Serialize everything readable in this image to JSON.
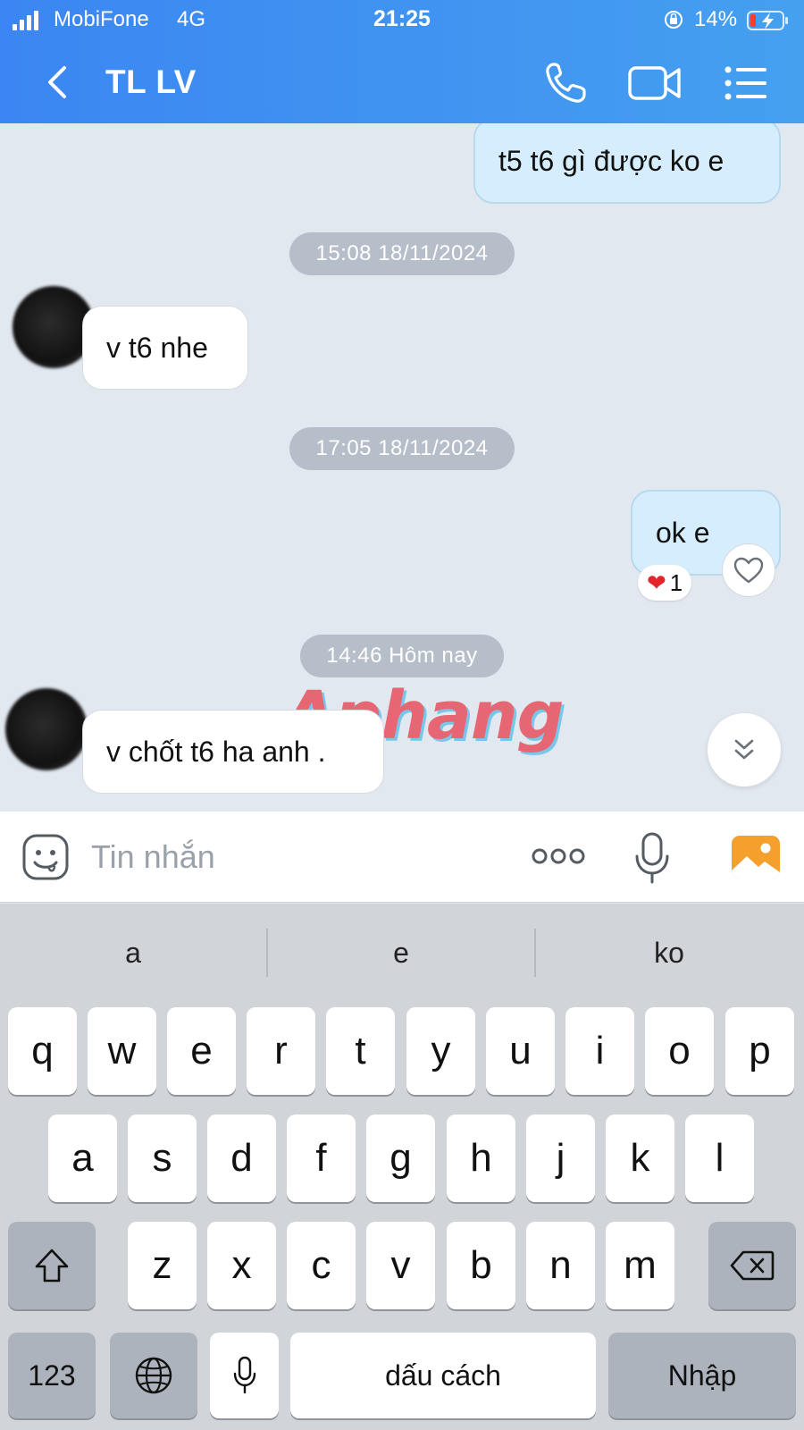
{
  "status_bar": {
    "carrier": "MobiFone",
    "network": "4G",
    "time": "21:25",
    "battery": "14%"
  },
  "header": {
    "title": "TL LV"
  },
  "messages": [
    {
      "sender": "me",
      "text": "t5 t6 gì được ko e"
    },
    {
      "type": "timestamp",
      "text": "15:08 18/11/2024"
    },
    {
      "sender": "them",
      "text": "v t6 nhe"
    },
    {
      "type": "timestamp",
      "text": "17:05 18/11/2024"
    },
    {
      "sender": "me",
      "text": "ok e",
      "reaction": {
        "emoji": "❤",
        "count": "1"
      }
    },
    {
      "type": "timestamp",
      "text": "14:46 Hôm nay"
    },
    {
      "sender": "them",
      "text": "v chốt t6 ha anh ."
    }
  ],
  "watermark": "Aphang",
  "composer": {
    "placeholder": "Tin nhắn"
  },
  "keyboard": {
    "suggestions": [
      "a",
      "e",
      "ko"
    ],
    "row1": [
      "q",
      "w",
      "e",
      "r",
      "t",
      "y",
      "u",
      "i",
      "o",
      "p"
    ],
    "row2": [
      "a",
      "s",
      "d",
      "f",
      "g",
      "h",
      "j",
      "k",
      "l"
    ],
    "row3": [
      "z",
      "x",
      "c",
      "v",
      "b",
      "n",
      "m"
    ],
    "numbers_label": "123",
    "space_label": "dấu cách",
    "return_label": "Nhập"
  },
  "icons": {
    "back": "chevron-left-icon",
    "call": "phone-icon",
    "video": "video-camera-icon",
    "menu": "list-menu-icon",
    "emoji": "emoji-icon",
    "more": "more-dots-icon",
    "mic": "microphone-icon",
    "photo": "image-icon",
    "like": "heart-outline-icon",
    "scroll_down": "double-chevron-down-icon",
    "shift": "shift-icon",
    "backspace": "backspace-icon",
    "globe": "globe-icon"
  },
  "colors": {
    "header_start": "#3b86f2",
    "header_end": "#45a0f0",
    "my_bubble": "#d5edfc",
    "their_bubble": "#ffffff",
    "chat_bg": "#e2e8f0",
    "photo_icon": "#f5a02c"
  }
}
